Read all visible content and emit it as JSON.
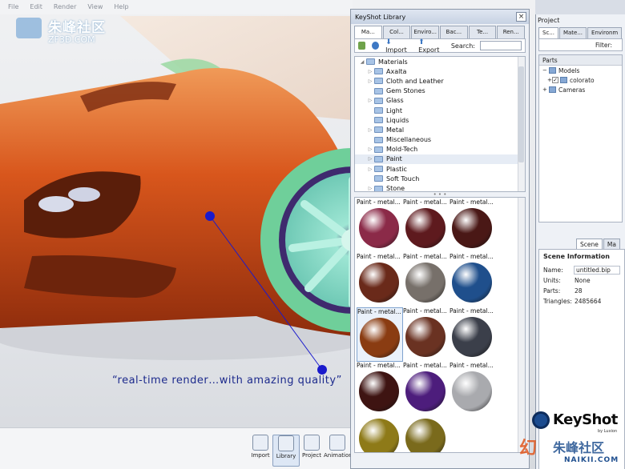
{
  "menu": [
    "File",
    "Edit",
    "Render",
    "View",
    "Help"
  ],
  "watermark_top": {
    "cn": "朱峰社区",
    "en": "ZF3D.COM"
  },
  "caption": "“real-time render…with amazing quality”",
  "toolbar": [
    {
      "label": "Import",
      "icon": "import-icon"
    },
    {
      "label": "Library",
      "icon": "library-icon"
    },
    {
      "label": "Project",
      "icon": "project-icon"
    },
    {
      "label": "Animation",
      "icon": "animation-icon"
    }
  ],
  "library": {
    "title": "KeyShot Library",
    "tabs": [
      "Ma...",
      "Col...",
      "Enviro...",
      "Bac...",
      "Te...",
      "Ren..."
    ],
    "import_label": "Import",
    "export_label": "Export",
    "search_label": "Search:",
    "tree": [
      {
        "label": "Materials",
        "level": 0,
        "expanded": true
      },
      {
        "label": "Axalta",
        "level": 1,
        "expandable": true
      },
      {
        "label": "Cloth and Leather",
        "level": 1,
        "expandable": true
      },
      {
        "label": "Gem Stones",
        "level": 1,
        "expandable": false
      },
      {
        "label": "Glass",
        "level": 1,
        "expandable": true
      },
      {
        "label": "Light",
        "level": 1,
        "expandable": false
      },
      {
        "label": "Liquids",
        "level": 1,
        "expandable": false
      },
      {
        "label": "Metal",
        "level": 1,
        "expandable": true
      },
      {
        "label": "Miscellaneous",
        "level": 1,
        "expandable": false
      },
      {
        "label": "Mold-Tech",
        "level": 1,
        "expandable": true
      },
      {
        "label": "Paint",
        "level": 1,
        "expandable": true,
        "selected": true
      },
      {
        "label": "Plastic",
        "level": 1,
        "expandable": true
      },
      {
        "label": "Soft Touch",
        "level": 1,
        "expandable": false
      },
      {
        "label": "Stone",
        "level": 1,
        "expandable": true
      }
    ],
    "materials": [
      {
        "label": "Paint - metal...",
        "color": "#8b2a48"
      },
      {
        "label": "Paint - metal...",
        "color": "#5e1a1e"
      },
      {
        "label": "Paint - metal...",
        "color": "#4a1816"
      },
      {
        "label": "Paint - metal...",
        "color": "#6a2a1a"
      },
      {
        "label": "Paint - metal...",
        "color": "#77706a"
      },
      {
        "label": "Paint - metal...",
        "color": "#1f4f8c"
      },
      {
        "label": "Paint - metal...",
        "color": "#8a3c12",
        "selected": true
      },
      {
        "label": "Paint - metal...",
        "color": "#6a3222"
      },
      {
        "label": "Paint - metal...",
        "color": "#3b3f4a"
      },
      {
        "label": "Paint - metal...",
        "color": "#3e1412"
      },
      {
        "label": "Paint - metal...",
        "color": "#4d1d7c"
      },
      {
        "label": "Paint - metal...",
        "color": "#a9aaae"
      },
      {
        "label": "",
        "color": "#8e7a18"
      },
      {
        "label": "",
        "color": "#7a6a1c"
      }
    ]
  },
  "project": {
    "title": "Project",
    "tabs": [
      "Sc...",
      "Mate...",
      "Environm"
    ],
    "filter_label": "Filter:",
    "parts_header": "Parts",
    "parts": [
      {
        "label": "Models",
        "level": 0
      },
      {
        "label": "colorato",
        "level": 1
      },
      {
        "label": "Cameras",
        "level": 0
      }
    ],
    "scene_tabs": [
      "Scene",
      "Ma"
    ],
    "scene_info_title": "Scene Information",
    "scene_info": {
      "name_label": "Name:",
      "name": "untitled.bip",
      "units_label": "Units:",
      "units": "None",
      "parts_label": "Parts:",
      "parts": "28",
      "triangles_label": "Triangles:",
      "triangles": "2485664"
    }
  },
  "keyshot_logo": {
    "text": "KeyShot",
    "sub": "by Luxion"
  },
  "watermark_bottom": {
    "cn": "幻",
    "cn2": "朱峰社区",
    "url": "NAIKII.COM"
  },
  "colors": {
    "car_body": "#d8561c",
    "wheel_rim": "#8fd9c6",
    "tire": "#6fcf9a",
    "caption": "#1c2a8c",
    "annotation": "#1a1acc"
  }
}
